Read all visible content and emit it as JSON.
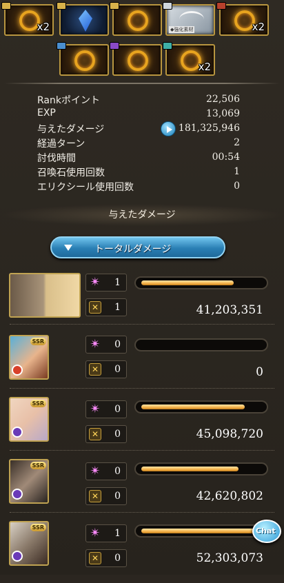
{
  "loot": {
    "row1": [
      {
        "icon": "gold-ring-icon",
        "chest": "gold",
        "qty": "x2"
      },
      {
        "icon": "blue-crystal-icon",
        "chest": "gold",
        "qty": ""
      },
      {
        "icon": "gold-ring-icon",
        "chest": "gold",
        "qty": ""
      },
      {
        "icon": "ornament-icon",
        "chest": "silver",
        "qty": "",
        "caption": "◆強化素材"
      },
      {
        "icon": "gold-ring-icon",
        "chest": "red",
        "qty": "x2"
      }
    ],
    "row2": [
      {
        "icon": "gold-ring-icon",
        "chest": "blue",
        "qty": ""
      },
      {
        "icon": "gold-ring-icon",
        "chest": "purple",
        "qty": ""
      },
      {
        "icon": "gold-ring-icon",
        "chest": "teal",
        "qty": "x2"
      }
    ]
  },
  "stats": [
    {
      "label": "Rankポイント",
      "value": "22,506"
    },
    {
      "label": "EXP",
      "value": "13,069"
    },
    {
      "label": "与えたダメージ",
      "value": "181,325,946"
    },
    {
      "label": "経過ターン",
      "value": "2"
    },
    {
      "label": "討伐時間",
      "value": "00:54"
    },
    {
      "label": "召喚石使用回数",
      "value": "1"
    },
    {
      "label": "エリクシール使用回数",
      "value": "0"
    }
  ],
  "damage_section": {
    "title": "与えたダメージ",
    "dropdown_label": "トータルダメージ"
  },
  "members": [
    {
      "ssr": "",
      "element": "",
      "buff": "1",
      "ougi": "1",
      "damage": "41,203,351",
      "bar": 0.77
    },
    {
      "ssr": "SSR",
      "element": "fire",
      "buff": "0",
      "ougi": "0",
      "damage": "0",
      "bar": 0.0
    },
    {
      "ssr": "SSR",
      "element": "dark",
      "buff": "0",
      "ougi": "0",
      "damage": "45,098,720",
      "bar": 0.86
    },
    {
      "ssr": "SSR",
      "element": "dark",
      "buff": "0",
      "ougi": "0",
      "damage": "42,620,802",
      "bar": 0.81
    },
    {
      "ssr": "SSR",
      "element": "dark",
      "buff": "1",
      "ougi": "0",
      "damage": "52,303,073",
      "bar": 1.0
    }
  ],
  "chat_label": "Chat",
  "colors": {
    "accent": "#2a7fb4",
    "bar": "#f4b24a",
    "frame": "#c0a352"
  }
}
